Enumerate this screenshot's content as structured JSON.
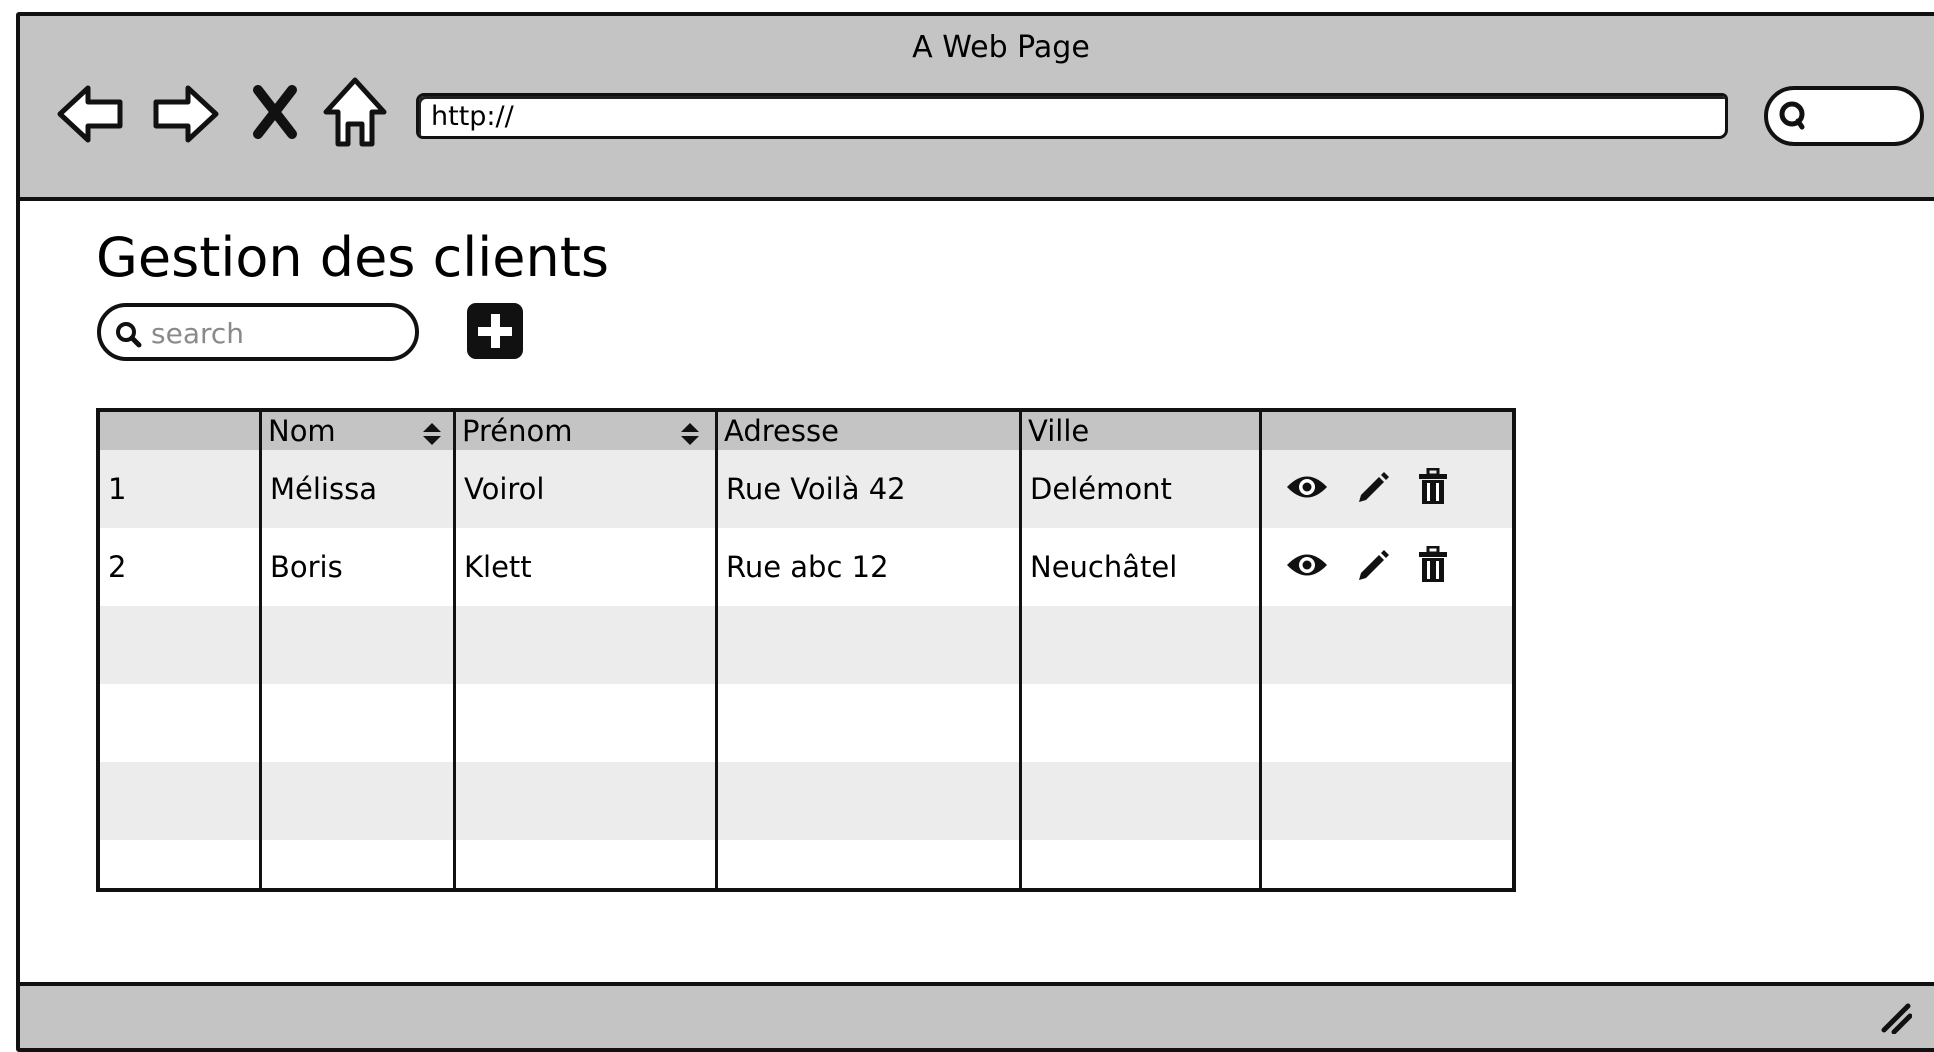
{
  "browser": {
    "title": "A Web Page",
    "url": "http://",
    "nav_icons": [
      "back-arrow-icon",
      "forward-arrow-icon",
      "stop-x-icon",
      "home-icon"
    ]
  },
  "page": {
    "title": "Gestion des clients",
    "search_placeholder": "search",
    "add_icon": "plus-square-icon"
  },
  "table": {
    "columns": [
      {
        "label": "",
        "sortable": false
      },
      {
        "label": "Nom",
        "sortable": true
      },
      {
        "label": "Prénom",
        "sortable": true
      },
      {
        "label": "Adresse",
        "sortable": false
      },
      {
        "label": "Ville",
        "sortable": false
      },
      {
        "label": "",
        "sortable": false
      }
    ],
    "rows": [
      {
        "id": "1",
        "nom": "Mélissa",
        "prenom": "Voirol",
        "adresse": "Rue Voilà 42",
        "ville": "Delémont"
      },
      {
        "id": "2",
        "nom": "Boris",
        "prenom": "Klett",
        "adresse": "Rue abc 12",
        "ville": "Neuchâtel"
      }
    ],
    "row_actions": [
      "eye-icon",
      "pencil-icon",
      "trash-icon"
    ],
    "colors": {
      "header_bg": "#c4c4c4",
      "alt_row_bg": "#ececec",
      "border": "#111111"
    }
  }
}
